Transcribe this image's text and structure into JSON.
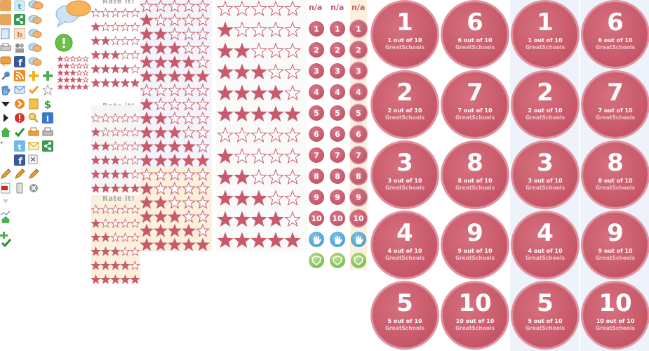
{
  "colors": {
    "star": "#c85a6b",
    "badge": "#c85a6b",
    "cream": "#fbf0dc",
    "bluepanel": "#eef3fb"
  },
  "rate_labels": [
    "Rate it!",
    "Rate it!",
    "Rate it!"
  ],
  "na_labels": [
    "n/a",
    "n/a",
    "n/a"
  ],
  "small_badge_numbers": [
    "1",
    "2",
    "3",
    "4",
    "5",
    "6",
    "7",
    "8",
    "9",
    "10"
  ],
  "score_badges": [
    {
      "num": "1",
      "sub": "1 out of 10",
      "brand": "GreatSchools"
    },
    {
      "num": "6",
      "sub": "6 out of 10",
      "brand": "GreatSchools"
    },
    {
      "num": "1",
      "sub": "1 out of 10",
      "brand": "GreatSchools"
    },
    {
      "num": "6",
      "sub": "6 out of 10",
      "brand": "GreatSchools"
    },
    {
      "num": "2",
      "sub": "2 out of 10",
      "brand": "GreatSchools"
    },
    {
      "num": "7",
      "sub": "7 out of 10",
      "brand": "GreatSchools"
    },
    {
      "num": "2",
      "sub": "2 out of 10",
      "brand": "GreatSchools"
    },
    {
      "num": "7",
      "sub": "7 out of 10",
      "brand": "GreatSchools"
    },
    {
      "num": "3",
      "sub": "3 out of 10",
      "brand": "GreatSchools"
    },
    {
      "num": "8",
      "sub": "8 out of 10",
      "brand": "GreatSchools"
    },
    {
      "num": "3",
      "sub": "3 out of 10",
      "brand": "GreatSchools"
    },
    {
      "num": "8",
      "sub": "8 out of 10",
      "brand": "GreatSchools"
    },
    {
      "num": "4",
      "sub": "4 out of 10",
      "brand": "GreatSchools"
    },
    {
      "num": "9",
      "sub": "9 out of 10",
      "brand": "GreatSchools"
    },
    {
      "num": "4",
      "sub": "4 out of 10",
      "brand": "GreatSchools"
    },
    {
      "num": "9",
      "sub": "9 out of 10",
      "brand": "GreatSchools"
    },
    {
      "num": "5",
      "sub": "5 out of 10",
      "brand": "GreatSchools"
    },
    {
      "num": "10",
      "sub": "10 out of 10",
      "brand": "GreatSchools"
    },
    {
      "num": "5",
      "sub": "5 out of 10",
      "brand": "GreatSchools"
    },
    {
      "num": "10",
      "sub": "10 out of 10",
      "brand": "GreatSchools"
    }
  ]
}
